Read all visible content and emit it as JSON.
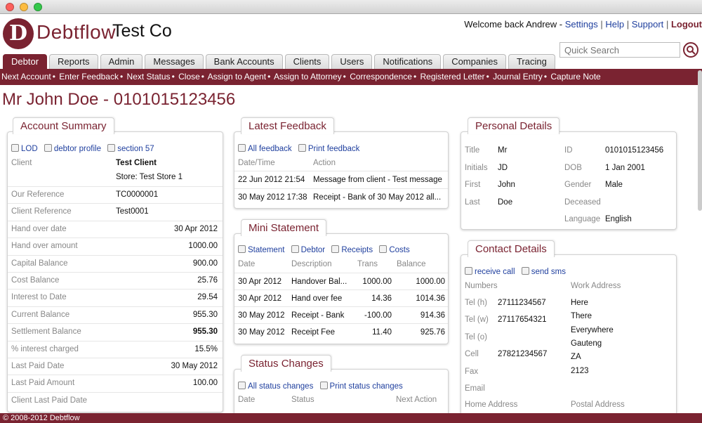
{
  "app": {
    "logo_letter": "D",
    "logo_name": "Debtflow",
    "company": "Test Co"
  },
  "toplinks": {
    "welcome": "Welcome back Andrew -",
    "settings": "Settings",
    "help": "Help",
    "support": "Support",
    "logout": "Logout",
    "sep": "|"
  },
  "search": {
    "placeholder": "Quick Search"
  },
  "tabs": [
    "Debtor",
    "Reports",
    "Admin",
    "Messages",
    "Bank Accounts",
    "Clients",
    "Users",
    "Notifications",
    "Companies",
    "Tracing"
  ],
  "actions": [
    "Next Account",
    "Enter Feedback",
    "Next Status",
    "Close",
    "Assign to Agent",
    "Assign to Attorney",
    "Correspondence",
    "Registered Letter",
    "Journal Entry",
    "Capture Note"
  ],
  "action_sep": "•",
  "page_title": "Mr John Doe - 0101015123456",
  "account_summary": {
    "title": "Account Summary",
    "links": [
      "LOD",
      "debtor profile",
      "section 57"
    ],
    "client_label": "Client",
    "client_name": "Test Client",
    "client_store": "Store: Test Store 1",
    "rows": [
      {
        "label": "Our Reference",
        "value": "TC0000001"
      },
      {
        "label": "Client Reference",
        "value": "Test0001"
      },
      {
        "label": "Hand over date",
        "value": "30 Apr 2012"
      },
      {
        "label": "Hand over amount",
        "value": "1000.00"
      },
      {
        "label": "Capital Balance",
        "value": "900.00"
      },
      {
        "label": "Cost Balance",
        "value": "25.76"
      },
      {
        "label": "Interest to Date",
        "value": "29.54"
      },
      {
        "label": "Current Balance",
        "value": "955.30"
      },
      {
        "label": "Settlement Balance",
        "value": "955.30"
      },
      {
        "label": "% interest charged",
        "value": "15.5%"
      },
      {
        "label": "Last Paid Date",
        "value": "30 May 2012"
      },
      {
        "label": "Last Paid Amount",
        "value": "100.00"
      },
      {
        "label": "Client Last Paid Date",
        "value": ""
      }
    ]
  },
  "latest_feedback": {
    "title": "Latest Feedback",
    "links": [
      "All feedback",
      "Print feedback"
    ],
    "headers": [
      "Date/Time",
      "Action"
    ],
    "rows": [
      [
        "22 Jun 2012 21:54",
        "Message from client - Test message"
      ],
      [
        "30 May 2012 17:38",
        "Receipt - Bank of 30 May 2012 all..."
      ]
    ]
  },
  "mini_statement": {
    "title": "Mini Statement",
    "links": [
      "Statement",
      "Debtor",
      "Receipts",
      "Costs"
    ],
    "headers": [
      "Date",
      "Description",
      "Trans",
      "Balance"
    ],
    "rows": [
      [
        "30 Apr 2012",
        "Handover Bal...",
        "1000.00",
        "1000.00"
      ],
      [
        "30 Apr 2012",
        "Hand over fee",
        "14.36",
        "1014.36"
      ],
      [
        "30 May 2012",
        "Receipt - Bank",
        "-100.00",
        "914.36"
      ],
      [
        "30 May 2012",
        "Receipt Fee",
        "11.40",
        "925.76"
      ]
    ]
  },
  "status_changes": {
    "title": "Status Changes",
    "links": [
      "All status changes",
      "Print status changes"
    ],
    "headers": [
      "Date",
      "Status",
      "Next Action"
    ]
  },
  "personal_details": {
    "title": "Personal Details",
    "left": [
      [
        "Title",
        "Mr"
      ],
      [
        "Initials",
        "JD"
      ],
      [
        "First",
        "John"
      ],
      [
        "Last",
        "Doe"
      ]
    ],
    "right": [
      [
        "ID",
        "0101015123456"
      ],
      [
        "DOB",
        "1 Jan 2001"
      ],
      [
        "Gender",
        "Male"
      ],
      [
        "Deceased",
        ""
      ],
      [
        "Language",
        "English"
      ]
    ]
  },
  "contact_details": {
    "title": "Contact Details",
    "links": [
      "receive call",
      "send sms"
    ],
    "numbers_header": "Numbers",
    "work_header": "Work Address",
    "numbers": [
      [
        "Tel (h)",
        "27111234567"
      ],
      [
        "Tel (w)",
        "27117654321"
      ],
      [
        "Tel (o)",
        ""
      ],
      [
        "Cell",
        "27821234567"
      ],
      [
        "Fax",
        ""
      ],
      [
        "Email",
        ""
      ]
    ],
    "work_address": [
      "Here",
      "There",
      "Everywhere",
      "Gauteng",
      "ZA",
      "2123"
    ],
    "home_header": "Home Address",
    "postal_header": "Postal Address"
  },
  "footer": "© 2008-2012 Debtflow",
  "colors": {
    "brand": "#7a2331",
    "link": "#1f3f9e"
  }
}
